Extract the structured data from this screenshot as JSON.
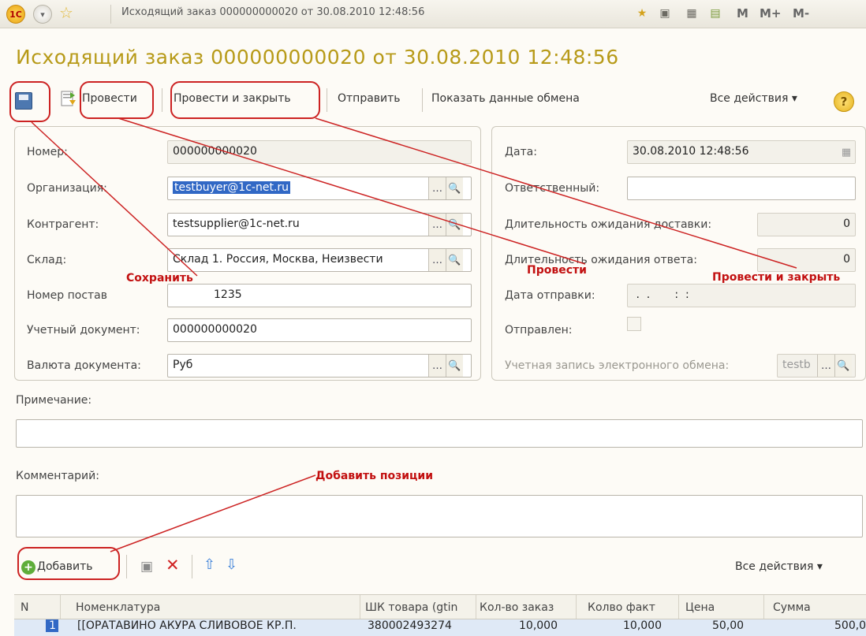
{
  "titlebar": {
    "window_title": "Исходящий заказ 000000000020 от 30.08.2010 12:48:56",
    "logo_text": "1С",
    "memory_buttons": [
      "M",
      "M+",
      "M-"
    ]
  },
  "header": {
    "title": "Исходящий заказ 000000000020 от 30.08.2010 12:48:56"
  },
  "toolbar": {
    "post_label": "Провести",
    "post_close_label": "Провести и закрыть",
    "send_label": "Отправить",
    "exchange_label": "Показать данные обмена",
    "all_actions_label": "Все действия ▾",
    "help_label": "?"
  },
  "left_panel": {
    "number_label": "Номер:",
    "number_value": "000000000020",
    "org_label": "Организация:",
    "org_value": "testbuyer@1c-net.ru",
    "counterparty_label": "Контрагент:",
    "counterparty_value": "testsupplier@1c-net.ru",
    "warehouse_label": "Склад:",
    "warehouse_value": "Склад 1. Россия, Москва, Неизвести",
    "supplier_no_label": "Номер постав",
    "supplier_no_value": "1235",
    "account_doc_label": "Учетный документ:",
    "account_doc_value": "000000000020",
    "currency_label": "Валюта документа:",
    "currency_value": "Руб"
  },
  "right_panel": {
    "date_label": "Дата:",
    "date_value": "30.08.2010 12:48:56",
    "responsible_label": "Ответственный:",
    "responsible_value": "",
    "delivery_wait_label": "Длительность ожидания доставки:",
    "delivery_wait_value": "0",
    "response_wait_label": "Длительность ожидания ответа:",
    "response_wait_value": "0",
    "send_date_label": "Дата отправки:",
    "send_date_value": " .  .       :  :",
    "sent_label": "Отправлен:",
    "exchange_account_label": "Учетная запись электронного обмена:",
    "exchange_account_value": "testb"
  },
  "note": {
    "label": "Примечание:",
    "value": ""
  },
  "comment": {
    "label": "Комментарий:",
    "value": ""
  },
  "table_toolbar": {
    "add_label": "Добавить",
    "all_actions_label": "Все действия ▾"
  },
  "table": {
    "columns": [
      "N",
      "Номенклатура",
      "ШК товара (gtin",
      "Кол-во заказ",
      "Колво факт",
      "Цена",
      "Сумма"
    ],
    "rows": [
      [
        "1",
        "[[ОРАТАВИНО АКУРА СЛИВОВОЕ КР.П.",
        "380002493274",
        "10,000",
        "10,000",
        "50,00",
        "500,0"
      ]
    ]
  },
  "annotations": {
    "save": "Сохранить",
    "post": "Провести",
    "post_close": "Провести и закрыть",
    "add_items": "Добавить позиции"
  },
  "colors": {
    "title": "#b79a18",
    "annotation": "#c21010",
    "selection": "#3168c5"
  }
}
